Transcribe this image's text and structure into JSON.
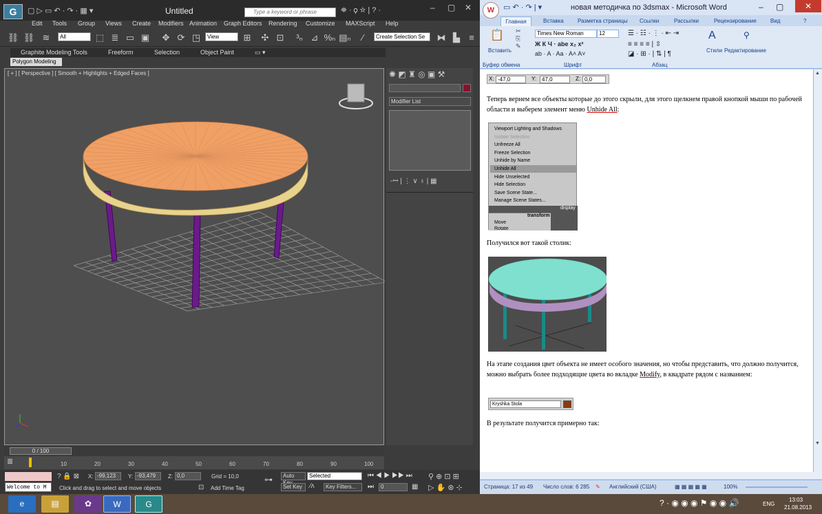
{
  "max": {
    "title": "Untitled",
    "search_placeholder": "Type a keyword or phrase",
    "menu": [
      "Edit",
      "Tools",
      "Group",
      "Views",
      "Create",
      "Modifiers",
      "Animation",
      "Graph Editors",
      "Rendering",
      "Customize",
      "MAXScript",
      "Help"
    ],
    "toolbar": {
      "filter": "All",
      "view": "View",
      "selection_set": "Create Selection Se"
    },
    "ribbon_tabs": [
      "Graphite Modeling Tools",
      "Freeform",
      "Selection",
      "Object Paint"
    ],
    "ribbon_subtab": "Polygon Modeling",
    "viewport_label": "[ + ] [ Perspective ] [ Smooth + Highlights + Edged Faces ]",
    "modifier_list": "Modifier List",
    "timeline": {
      "frame": "0 / 100",
      "ticks": [
        "10",
        "20",
        "30",
        "40",
        "50",
        "60",
        "70",
        "80",
        "90",
        "100"
      ]
    },
    "status": {
      "x_label": "X:",
      "x": "-99,123",
      "y_label": "Y:",
      "y": "-93,479",
      "z_label": "Z:",
      "z": "0,0",
      "grid": "Grid = 10,0",
      "autokey": "Auto Key",
      "selected": "Selected",
      "setkey": "Set Key",
      "keyfilters": "Key Filters...",
      "frame_field": "0",
      "prompt": "Click and drag to select and move objects",
      "add_time_tag": "Add Time Tag",
      "listener": "Welcome to M"
    }
  },
  "word": {
    "title": "новая методичка по 3dsmax - Microsoft Word",
    "tabs": [
      "Главная",
      "Вставка",
      "Разметка страницы",
      "Ссылки",
      "Рассылки",
      "Рецензирование",
      "Вид"
    ],
    "font": "Times New Roman",
    "font_size": "12",
    "groups": {
      "clipboard": "Буфер обмена",
      "font": "Шрифт",
      "paragraph": "Абзац",
      "paste": "Вставить",
      "styles": "Стили",
      "editing": "Редактирование"
    },
    "coord_bar": {
      "x_label": "X:",
      "x": "-47,0",
      "y_label": "Y:",
      "y": "47,0",
      "z_label": "Z:",
      "z": "0,0"
    },
    "para1": "Теперь вернем все объекты которые до этого скрыли, для этого щелкнем правой кнопкой мыши по рабочей области и выберем элемент меню",
    "para1_link": "Unhide All",
    "para1_end": ":",
    "context_menu": [
      "Viewport Lighting and Shadows",
      "Isolate Selection",
      "Unfreeze All",
      "Freeze Selection",
      "Unhide by Name",
      "Unhide All",
      "Hide Unselected",
      "Hide Selection",
      "Save Scene State...",
      "Manage Scene States..."
    ],
    "context_display": "display",
    "context_transform": "transform",
    "context_move": "Move",
    "context_rotate": "Rotate",
    "para2": "Получился вот такой столик:",
    "para3_a": "На этапе создания цвет объекта не имеет особого значения, но чтобы представить, что должно получится, можно выбрать более подходящие цвета во вкладке",
    "para3_link": "Modify",
    "para3_b": ", в квадрате рядом с названием:",
    "name_field": "Kryshka Stola",
    "para4": "В результате получится примерно так:",
    "status": {
      "page": "Страница: 17 из 49",
      "words": "Число слов: 6 285",
      "lang": "Английский (США)",
      "zoom": "100%"
    }
  },
  "taskbar": {
    "lang": "ENG",
    "time": "13:03",
    "date": "21.08.2013"
  },
  "colors": {
    "tabletop": "#f0a064",
    "legs": "#6a1a8a",
    "teal": "#7fe0d0",
    "swatch_red": "#8a1030",
    "swatch_brown": "#8a3a10"
  }
}
